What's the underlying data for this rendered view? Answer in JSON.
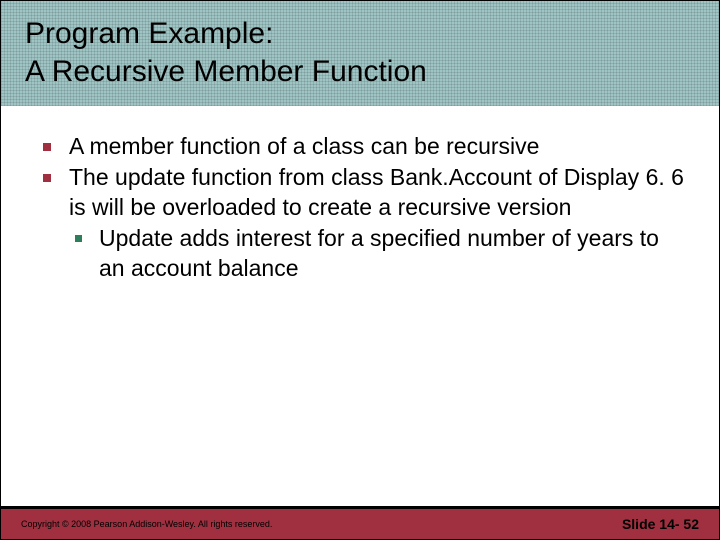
{
  "title_line1": "Program Example:",
  "title_line2": "A Recursive Member Function",
  "bullets": {
    "b1": "A member function of a class can be recursive",
    "b2": "The update function from class Bank.Account of Display 6. 6 is will be overloaded to create a recursive version",
    "b2_sub1": "Update adds interest for a specified number of years to an account balance"
  },
  "footer": {
    "copyright": "Copyright © 2008 Pearson Addison-Wesley. All rights reserved.",
    "slide_label": "Slide 14- 52"
  },
  "colors": {
    "title_bg": "#9fc4c4",
    "bullet_lvl1": "#a03040",
    "bullet_lvl2": "#2e7d5b",
    "footer_bg": "#a03040"
  }
}
